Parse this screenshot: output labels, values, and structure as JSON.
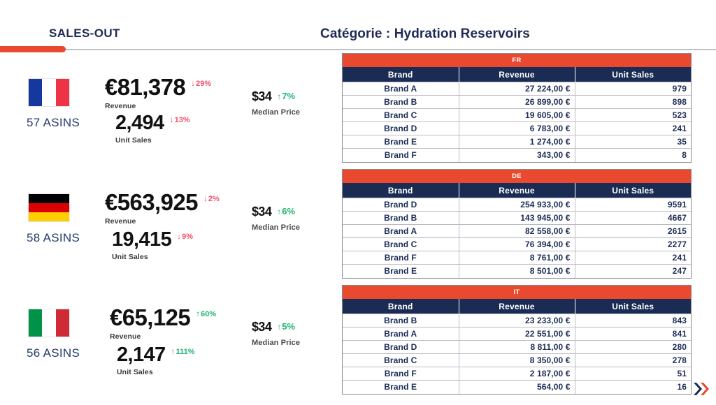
{
  "header": {
    "left_title": "SALES-OUT",
    "category_title": "Catégorie : Hydration Reservoirs",
    "accent_color": "#e8492f",
    "navy_color": "#1b2c54"
  },
  "kpi_blocks": [
    {
      "country_code": "FR",
      "flag": "france-flag",
      "asins": "57 ASINS",
      "revenue": {
        "value": "€81,378",
        "label": "Revenue",
        "delta": "29%",
        "direction": "down",
        "arrow": "↓"
      },
      "units": {
        "value": "2,494",
        "label": "Unit Sales",
        "delta": "13%",
        "direction": "down",
        "arrow": "↓"
      },
      "price": {
        "value": "$34",
        "label": "Median Price",
        "delta": "7%",
        "direction": "up",
        "arrow": "↑"
      }
    },
    {
      "country_code": "DE",
      "flag": "germany-flag",
      "asins": "58 ASINS",
      "revenue": {
        "value": "€563,925",
        "label": "Revenue",
        "delta": "2%",
        "direction": "down",
        "arrow": "↓"
      },
      "units": {
        "value": "19,415",
        "label": "Unit Sales",
        "delta": "9%",
        "direction": "down",
        "arrow": "↓"
      },
      "price": {
        "value": "$34",
        "label": "Median Price",
        "delta": "6%",
        "direction": "up",
        "arrow": "↑"
      }
    },
    {
      "country_code": "IT",
      "flag": "italy-flag",
      "asins": "56 ASINS",
      "revenue": {
        "value": "€65,125",
        "label": "Revenue",
        "delta": "60%",
        "direction": "up",
        "arrow": "↑"
      },
      "units": {
        "value": "2,147",
        "label": "Unit Sales",
        "delta": "111%",
        "direction": "up",
        "arrow": "↑"
      },
      "price": {
        "value": "$34",
        "label": "Median Price",
        "delta": "5%",
        "direction": "up",
        "arrow": "↑"
      }
    }
  ],
  "tables": [
    {
      "country": "FR",
      "columns": [
        "Brand",
        "Revenue",
        "Unit Sales"
      ],
      "rows": [
        {
          "brand": "Brand A",
          "revenue": "27 224,00  €",
          "units": "979"
        },
        {
          "brand": "Brand B",
          "revenue": "26 899,00  €",
          "units": "898"
        },
        {
          "brand": "Brand C",
          "revenue": "19 605,00  €",
          "units": "523"
        },
        {
          "brand": "Brand D",
          "revenue": "6 783,00  €",
          "units": "241"
        },
        {
          "brand": "Brand E",
          "revenue": "1 274,00  €",
          "units": "35"
        },
        {
          "brand": "Brand F",
          "revenue": "343,00  €",
          "units": "8"
        }
      ]
    },
    {
      "country": "DE",
      "columns": [
        "Brand",
        "Revenue",
        "Unit Sales"
      ],
      "rows": [
        {
          "brand": "Brand D",
          "revenue": "254 933,00  €",
          "units": "9591"
        },
        {
          "brand": "Brand B",
          "revenue": "143 945,00  €",
          "units": "4667"
        },
        {
          "brand": "Brand A",
          "revenue": "82 558,00  €",
          "units": "2615"
        },
        {
          "brand": "Brand C",
          "revenue": "76 394,00  €",
          "units": "2277"
        },
        {
          "brand": "Brand F",
          "revenue": "8 761,00  €",
          "units": "241"
        },
        {
          "brand": "Brand E",
          "revenue": "8 501,00  €",
          "units": "247"
        }
      ]
    },
    {
      "country": "IT",
      "columns": [
        "Brand",
        "Revenue",
        "Unit Sales"
      ],
      "rows": [
        {
          "brand": "Brand B",
          "revenue": "23 233,00  €",
          "units": "843"
        },
        {
          "brand": "Brand A",
          "revenue": "22 551,00  €",
          "units": "841"
        },
        {
          "brand": "Brand D",
          "revenue": "8 811,00  €",
          "units": "280"
        },
        {
          "brand": "Brand C",
          "revenue": "8 350,00  €",
          "units": "278"
        },
        {
          "brand": "Brand F",
          "revenue": "2 187,00  €",
          "units": "51"
        },
        {
          "brand": "Brand E",
          "revenue": "564,00  €",
          "units": "16"
        }
      ]
    }
  ],
  "logo": {
    "name": "double-chevron-logo",
    "navy": "#1b2c54",
    "red": "#e8492f"
  }
}
